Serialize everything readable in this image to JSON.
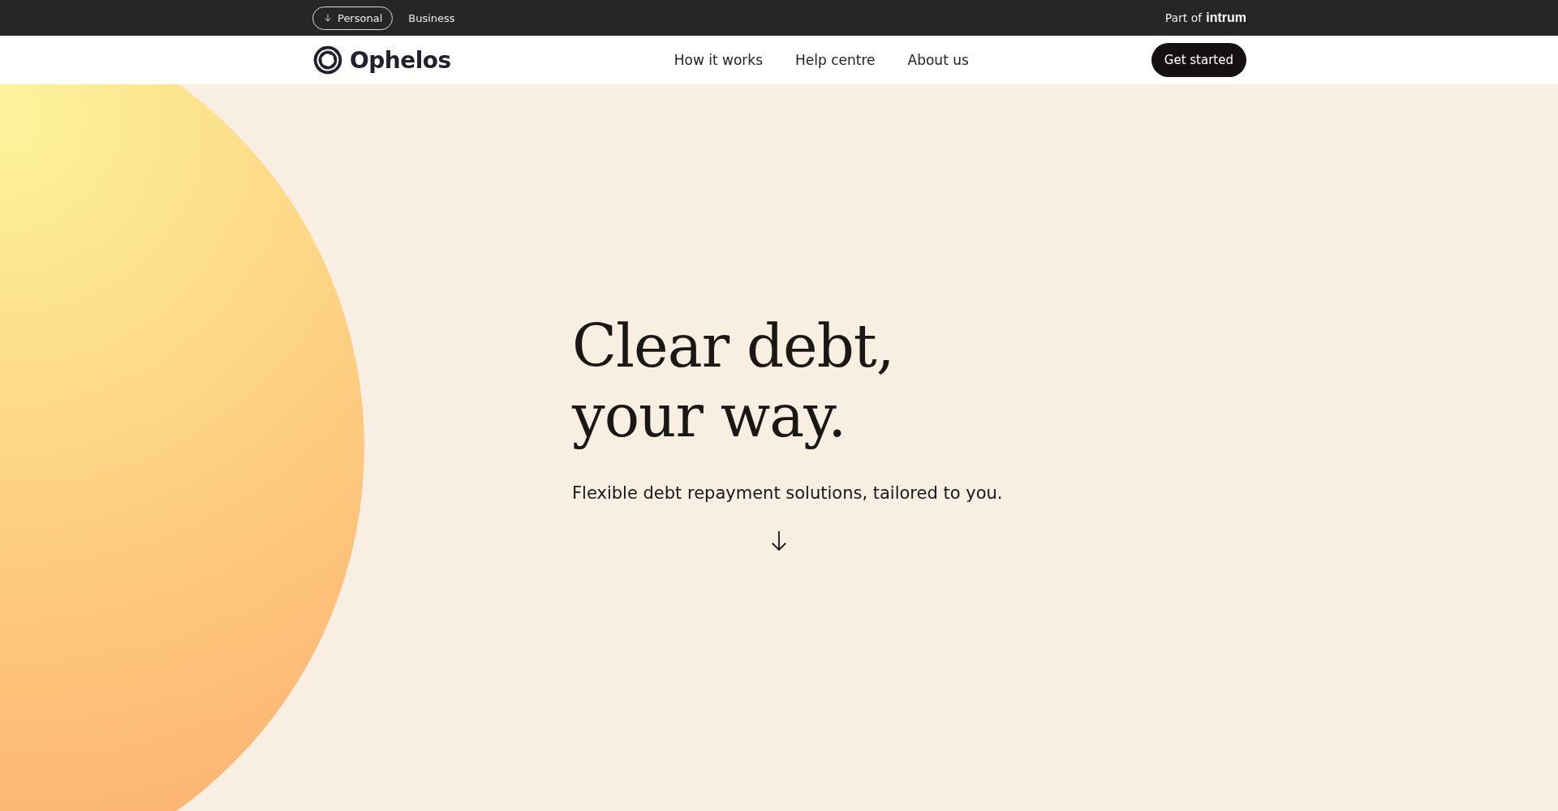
{
  "audience_tabs": [
    {
      "label": "Personal",
      "selected": true
    },
    {
      "label": "Business",
      "selected": false
    }
  ],
  "parent_brand": {
    "prefix": "Part of",
    "name": "intrum"
  },
  "logo": {
    "text": "Ophelos"
  },
  "nav": {
    "links": [
      "How it works",
      "Help centre",
      "About us"
    ],
    "cta": "Get started"
  },
  "hero": {
    "headline_lines": [
      "Clear debt,",
      "your way."
    ],
    "subtitle": "Flexible debt repayment solutions, tailored to you."
  }
}
